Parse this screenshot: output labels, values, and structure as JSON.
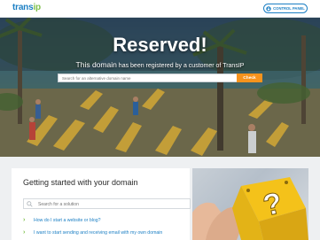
{
  "topbar": {
    "logo_main": "trans",
    "logo_accent": "ip",
    "control_panel_label": "CONTROL PANEL"
  },
  "hero": {
    "title": "Reserved!",
    "subtitle_lead": "This domain",
    "subtitle_rest": " has been registered by a customer of TransIP",
    "search_placeholder": "Search for an alternative domain name",
    "check_label": "Check"
  },
  "getting_started": {
    "title": "Getting started with your domain",
    "search_placeholder": "Search for a solution",
    "faq": [
      "How do I start a website or blog?",
      "I want to start sending and receiving email with my own domain"
    ]
  },
  "colors": {
    "brand_blue": "#1b7fc4",
    "brand_green": "#7ec04b",
    "check_orange": "#f6931d"
  }
}
